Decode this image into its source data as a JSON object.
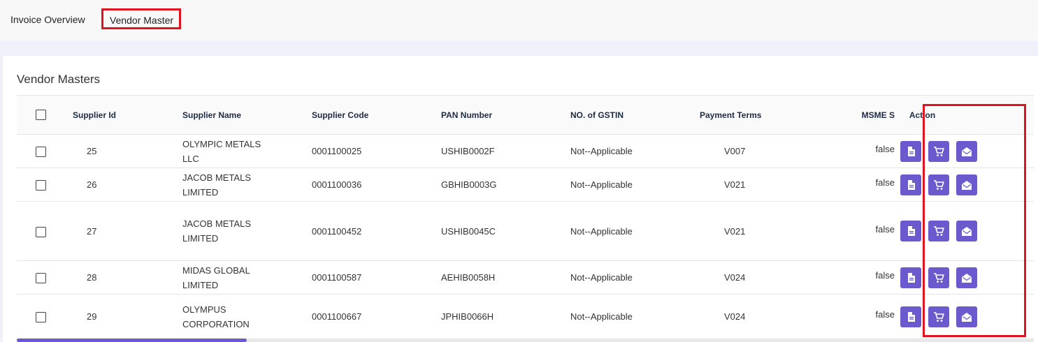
{
  "tabs": {
    "invoice_overview": "Invoice Overview",
    "vendor_master": "Vendor Master"
  },
  "card": {
    "title": "Vendor Masters"
  },
  "table": {
    "headers": {
      "supplier_id": "Supplier Id",
      "supplier_name": "Supplier Name",
      "supplier_code": "Supplier Code",
      "pan_number": "PAN Number",
      "gstin": "NO. of GSTIN",
      "payment_terms": "Payment Terms",
      "msme": "MSME S",
      "action": "Action"
    },
    "rows": [
      {
        "id": "25",
        "name_line1": "OLYMPIC METALS",
        "name_line2": "LLC",
        "code": "0001100025",
        "pan": "USHIB0002F",
        "gstin": "Not--Applicable",
        "terms": "V007",
        "msme": "false"
      },
      {
        "id": "26",
        "name_line1": "JACOB METALS",
        "name_line2": "LIMITED",
        "code": "0001100036",
        "pan": "GBHIB0003G",
        "gstin": "Not--Applicable",
        "terms": "V021",
        "msme": "false"
      },
      {
        "id": "27",
        "name_line1": "JACOB METALS",
        "name_line2": "LIMITED",
        "code": "0001100452",
        "pan": "USHIB0045C",
        "gstin": "Not--Applicable",
        "terms": "V021",
        "msme": "false"
      },
      {
        "id": "28",
        "name_line1": "MIDAS GLOBAL",
        "name_line2": "LIMITED",
        "code": "0001100587",
        "pan": "AEHIB0058H",
        "gstin": "Not--Applicable",
        "terms": "V024",
        "msme": "false"
      },
      {
        "id": "29",
        "name_line1": "OLYMPUS",
        "name_line2": "CORPORATION",
        "code": "0001100667",
        "pan": "JPHIB0066H",
        "gstin": "Not--Applicable",
        "terms": "V024",
        "msme": "false"
      }
    ]
  },
  "action_icons": [
    "document-icon",
    "cart-icon",
    "mail-open-icon"
  ],
  "colors": {
    "accent": "#6a5acd",
    "highlight": "#e0141e",
    "header_text": "#1d2b45"
  }
}
